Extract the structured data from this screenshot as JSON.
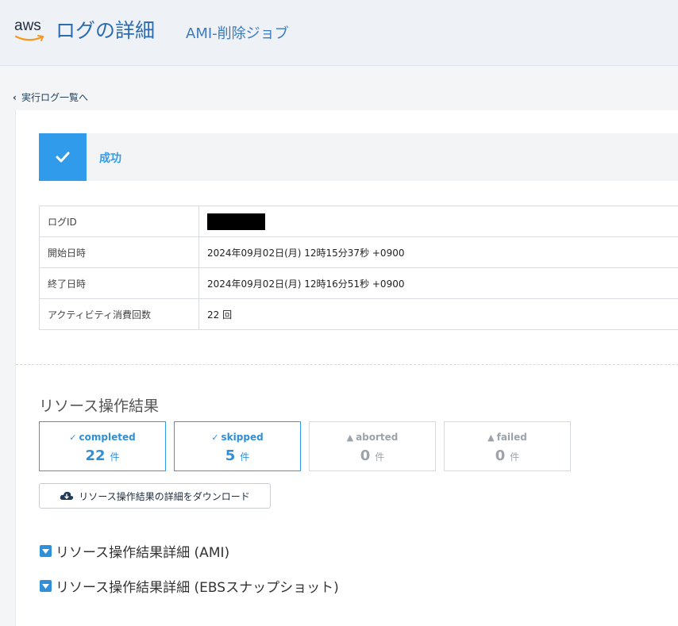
{
  "header": {
    "logo_text": "aws",
    "title": "ログの詳細",
    "job_name": "AMI-削除ジョブ"
  },
  "nav": {
    "back_label": "実行ログ一覧へ"
  },
  "status": {
    "label": "成功",
    "color": "#2f9bea"
  },
  "info_table": {
    "rows": [
      {
        "key": "ログID",
        "value": ""
      },
      {
        "key": "開始日時",
        "value": "2024年09月02日(月) 12時15分37秒 +0900"
      },
      {
        "key": "終了日時",
        "value": "2024年09月02日(月) 12時16分51秒 +0900"
      },
      {
        "key": "アクティビティ消費回数",
        "value": "22 回"
      }
    ]
  },
  "results": {
    "title": "リソース操作結果",
    "cards": [
      {
        "label": "completed",
        "icon": "check-icon",
        "count": "22",
        "unit": "件"
      },
      {
        "label": "skipped",
        "icon": "check-icon",
        "count": "5",
        "unit": "件"
      },
      {
        "label": "aborted",
        "icon": "warning-icon",
        "count": "0",
        "unit": "件"
      },
      {
        "label": "failed",
        "icon": "warning-icon",
        "count": "0",
        "unit": "件"
      }
    ],
    "download_label": "リソース操作結果の詳細をダウンロード"
  },
  "sections": [
    {
      "label": "リソース操作結果詳細 (AMI)"
    },
    {
      "label": "リソース操作結果詳細 (EBSスナップショット)"
    }
  ]
}
